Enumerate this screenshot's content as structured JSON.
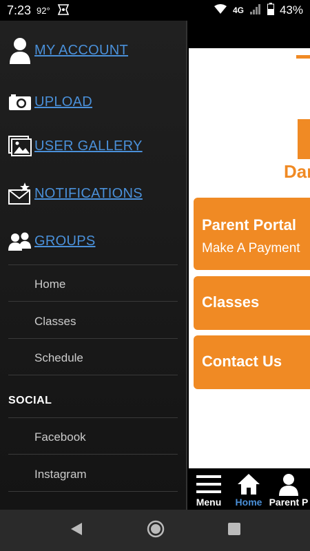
{
  "status": {
    "time": "7:23",
    "temperature": "92°",
    "network": "4G",
    "battery": "43%"
  },
  "drawer": {
    "hero_items": [
      {
        "label": "MY ACCOUNT",
        "icon": "user-icon"
      },
      {
        "label": "UPLOAD",
        "icon": "camera-icon"
      },
      {
        "label": "USER GALLERY",
        "icon": "gallery-icon"
      },
      {
        "label": "NOTIFICATIONS",
        "icon": "notification-envelope-icon"
      },
      {
        "label": "GROUPS",
        "icon": "groups-icon"
      }
    ],
    "menu_items": [
      "Home",
      "Classes",
      "Schedule"
    ],
    "social_title": "SOCIAL",
    "social_items": [
      "Facebook",
      "Instagram"
    ]
  },
  "content": {
    "logo_text": "Dar",
    "cards": [
      {
        "title": "Parent Portal",
        "subtitle": "Make A Payment"
      },
      {
        "title": "Classes"
      },
      {
        "title": "Contact Us"
      }
    ]
  },
  "tabbar": {
    "tabs": [
      {
        "label": "Menu",
        "icon": "hamburger-icon"
      },
      {
        "label": "Home",
        "icon": "home-icon",
        "active": true
      },
      {
        "label": "Parent P",
        "icon": "user-icon"
      }
    ]
  },
  "colors": {
    "accent_orange": "#f08a24",
    "link_blue": "#4a90d9",
    "drawer_bg": "#1b1b1b"
  }
}
